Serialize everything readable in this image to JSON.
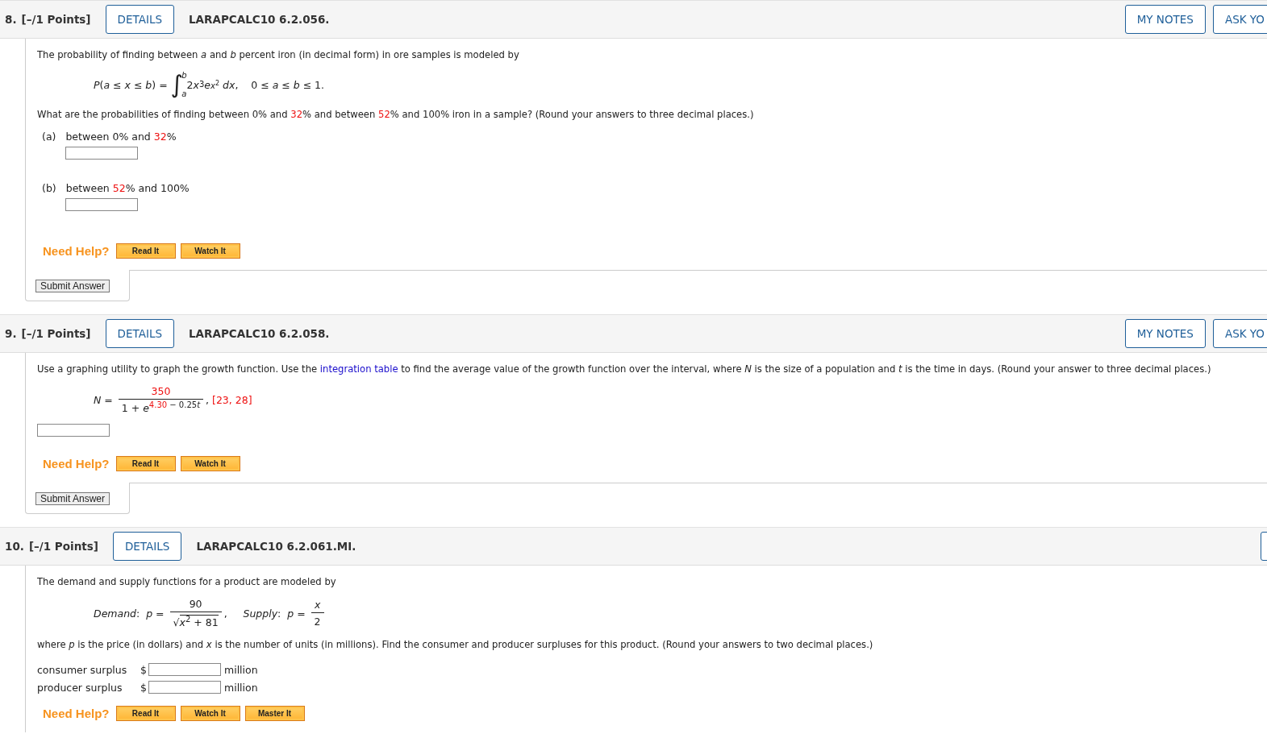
{
  "questions": [
    {
      "number": "8.",
      "points": "[–/1 Points]",
      "details": "DETAILS",
      "code": "LARAPCALC10 6.2.056.",
      "right_buttons": [
        "MY NOTES",
        "ASK YO"
      ],
      "edge_button": false,
      "blocks": [
        {
          "kind": "paragraph",
          "items": [
            {
              "kind": "text",
              "text": "The probability of finding between "
            },
            {
              "kind": "var",
              "text": "a"
            },
            {
              "kind": "text",
              "text": " and "
            },
            {
              "kind": "var",
              "text": "b"
            },
            {
              "kind": "text",
              "text": " percent iron (in decimal form) in ore samples is modeled by"
            }
          ]
        },
        {
          "kind": "formula",
          "items": [
            {
              "kind": "var",
              "text": "P"
            },
            {
              "kind": "text",
              "text": "("
            },
            {
              "kind": "var",
              "text": "a"
            },
            {
              "kind": "text",
              "text": " ≤ "
            },
            {
              "kind": "var",
              "text": "x"
            },
            {
              "kind": "text",
              "text": " ≤ "
            },
            {
              "kind": "var",
              "text": "b"
            },
            {
              "kind": "text",
              "text": ") = "
            },
            {
              "kind": "integral",
              "sign": "∫",
              "upper": "b",
              "lower": "a"
            },
            {
              "kind": "text",
              "text": "2"
            },
            {
              "kind": "var",
              "text": "x"
            },
            {
              "kind": "sup",
              "text": "3"
            },
            {
              "kind": "var",
              "text": "e"
            },
            {
              "kind": "supvar",
              "text": "x",
              "sup": "2"
            },
            {
              "kind": "var",
              "text": "dx"
            },
            {
              "kind": "text",
              "text": ",    0 ≤ "
            },
            {
              "kind": "var",
              "text": "a"
            },
            {
              "kind": "text",
              "text": " ≤ "
            },
            {
              "kind": "var",
              "text": "b"
            },
            {
              "kind": "text",
              "text": " ≤ 1."
            }
          ]
        },
        {
          "kind": "paragraph",
          "items": [
            {
              "kind": "text",
              "text": "What are the probabilities of finding between 0% and "
            },
            {
              "kind": "red",
              "text": "32"
            },
            {
              "kind": "text",
              "text": "% and between "
            },
            {
              "kind": "red",
              "text": "52"
            },
            {
              "kind": "text",
              "text": "% and 100% iron in a sample? (Round your answers to three decimal places.)"
            }
          ]
        },
        {
          "kind": "part",
          "label": "(a)",
          "items": [
            {
              "kind": "text",
              "text": "between 0% and "
            },
            {
              "kind": "red",
              "text": "32"
            },
            {
              "kind": "text",
              "text": "%"
            }
          ]
        },
        {
          "kind": "part",
          "label": "(b)",
          "items": [
            {
              "kind": "text",
              "text": "between "
            },
            {
              "kind": "red",
              "text": "52"
            },
            {
              "kind": "text",
              "text": "% and 100%"
            }
          ]
        }
      ],
      "help_label": "Need Help?",
      "help_buttons": [
        "Read It",
        "Watch It"
      ],
      "submit": "Submit Answer"
    },
    {
      "number": "9.",
      "points": "[–/1 Points]",
      "details": "DETAILS",
      "code": "LARAPCALC10 6.2.058.",
      "right_buttons": [
        "MY NOTES",
        "ASK YO"
      ],
      "edge_button": false,
      "blocks": [
        {
          "kind": "paragraph",
          "items": [
            {
              "kind": "text",
              "text": "Use a graphing utility to graph the growth function. Use the "
            },
            {
              "kind": "link",
              "text": "integration table"
            },
            {
              "kind": "text",
              "text": " to find the average value of the growth function over the interval, where "
            },
            {
              "kind": "var",
              "text": "N"
            },
            {
              "kind": "text",
              "text": " is the size of a population and "
            },
            {
              "kind": "var",
              "text": "t"
            },
            {
              "kind": "text",
              "text": " is the time in days. (Round your answer to three decimal places.)"
            }
          ]
        },
        {
          "kind": "formula",
          "items": [
            {
              "kind": "var",
              "text": "N"
            },
            {
              "kind": "text",
              "text": " = "
            },
            {
              "kind": "frac",
              "num": [
                {
                  "kind": "red",
                  "text": "350"
                }
              ],
              "den": [
                {
                  "kind": "text",
                  "text": "1 + "
                },
                {
                  "kind": "var",
                  "text": "e"
                },
                {
                  "kind": "supred",
                  "text": "4.30"
                },
                {
                  "kind": "sup",
                  "text": " − 0.25"
                },
                {
                  "kind": "supvar",
                  "text": "t"
                }
              ]
            },
            {
              "kind": "text",
              "text": ", "
            },
            {
              "kind": "red",
              "text": "[23, 28]"
            }
          ]
        },
        {
          "kind": "field"
        }
      ],
      "help_label": "Need Help?",
      "help_buttons": [
        "Read It",
        "Watch It"
      ],
      "submit": "Submit Answer"
    },
    {
      "number": "10.",
      "points": "[–/1 Points]",
      "details": "DETAILS",
      "code": "LARAPCALC10 6.2.061.MI.",
      "edge_button": true,
      "blocks": [
        {
          "kind": "paragraph",
          "items": [
            {
              "kind": "text",
              "text": "The demand and supply functions for a product are modeled by"
            }
          ]
        },
        {
          "kind": "formula",
          "items": [
            {
              "kind": "var",
              "text": "Demand"
            },
            {
              "kind": "text",
              "text": ":  "
            },
            {
              "kind": "var",
              "text": "p"
            },
            {
              "kind": "text",
              "text": " = "
            },
            {
              "kind": "frac",
              "num": [
                {
                  "kind": "text",
                  "text": "90"
                }
              ],
              "den": [
                {
                  "kind": "sqrt",
                  "sign": "√",
                  "items": [
                    {
                      "kind": "var",
                      "text": "x"
                    },
                    {
                      "kind": "sup",
                      "text": "2"
                    },
                    {
                      "kind": "text",
                      "text": " + 81"
                    }
                  ]
                }
              ]
            },
            {
              "kind": "text",
              "text": ",     "
            },
            {
              "kind": "var",
              "text": "Supply"
            },
            {
              "kind": "text",
              "text": ":  "
            },
            {
              "kind": "var",
              "text": "p"
            },
            {
              "kind": "text",
              "text": " = "
            },
            {
              "kind": "frac",
              "num": [
                {
                  "kind": "var",
                  "text": "x"
                }
              ],
              "den": [
                {
                  "kind": "text",
                  "text": "2"
                }
              ]
            }
          ]
        },
        {
          "kind": "paragraph",
          "items": [
            {
              "kind": "text",
              "text": "where "
            },
            {
              "kind": "var",
              "text": "p"
            },
            {
              "kind": "text",
              "text": " is the price (in dollars) and "
            },
            {
              "kind": "var",
              "text": "x"
            },
            {
              "kind": "text",
              "text": " is the number of units (in millions). Find the consumer and producer surpluses for this product. (Round your answers to two decimal places.)"
            }
          ]
        },
        {
          "kind": "row",
          "label": "consumer surplus",
          "prefix": "$",
          "suffix": "million"
        },
        {
          "kind": "row",
          "label": "producer surplus",
          "prefix": "$",
          "suffix": "million"
        }
      ],
      "help_label": "Need Help?",
      "help_buttons": [
        "Read It",
        "Watch It",
        "Master It"
      ]
    }
  ]
}
